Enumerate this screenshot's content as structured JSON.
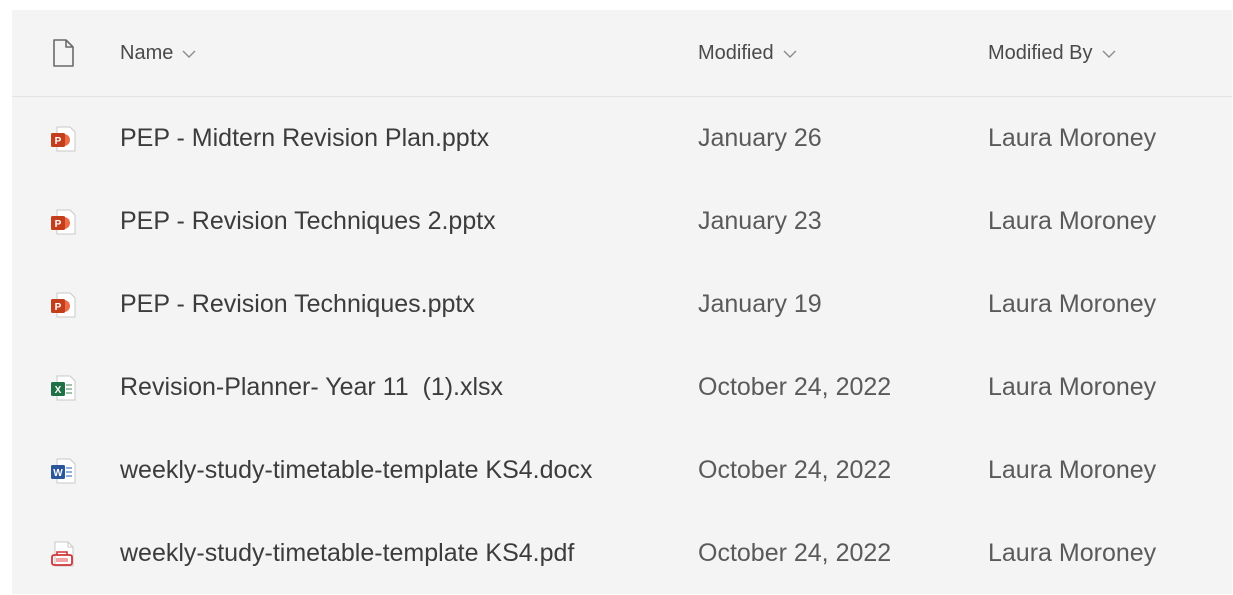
{
  "header": {
    "name_label": "Name",
    "modified_label": "Modified",
    "modified_by_label": "Modified By",
    "doc_icon": "document-icon",
    "sort_icon": "chevron-down-icon"
  },
  "colors": {
    "powerpoint": "#c43e1c",
    "excel": "#1e7145",
    "word": "#2b579a",
    "pdf": "#d13438"
  },
  "files": [
    {
      "icon": "powerpoint-icon",
      "name": "PEP - Midtern Revision Plan.pptx",
      "modified": "January 26",
      "modified_by": "Laura Moroney"
    },
    {
      "icon": "powerpoint-icon",
      "name": "PEP - Revision Techniques 2.pptx",
      "modified": "January 23",
      "modified_by": "Laura Moroney"
    },
    {
      "icon": "powerpoint-icon",
      "name": "PEP - Revision Techniques.pptx",
      "modified": "January 19",
      "modified_by": "Laura Moroney"
    },
    {
      "icon": "excel-icon",
      "name": "Revision-Planner- Year 11  (1).xlsx",
      "modified": "October 24, 2022",
      "modified_by": "Laura Moroney"
    },
    {
      "icon": "word-icon",
      "name": "weekly-study-timetable-template KS4.docx",
      "modified": "October 24, 2022",
      "modified_by": "Laura Moroney"
    },
    {
      "icon": "pdf-icon",
      "name": "weekly-study-timetable-template KS4.pdf",
      "modified": "October 24, 2022",
      "modified_by": "Laura Moroney"
    }
  ]
}
